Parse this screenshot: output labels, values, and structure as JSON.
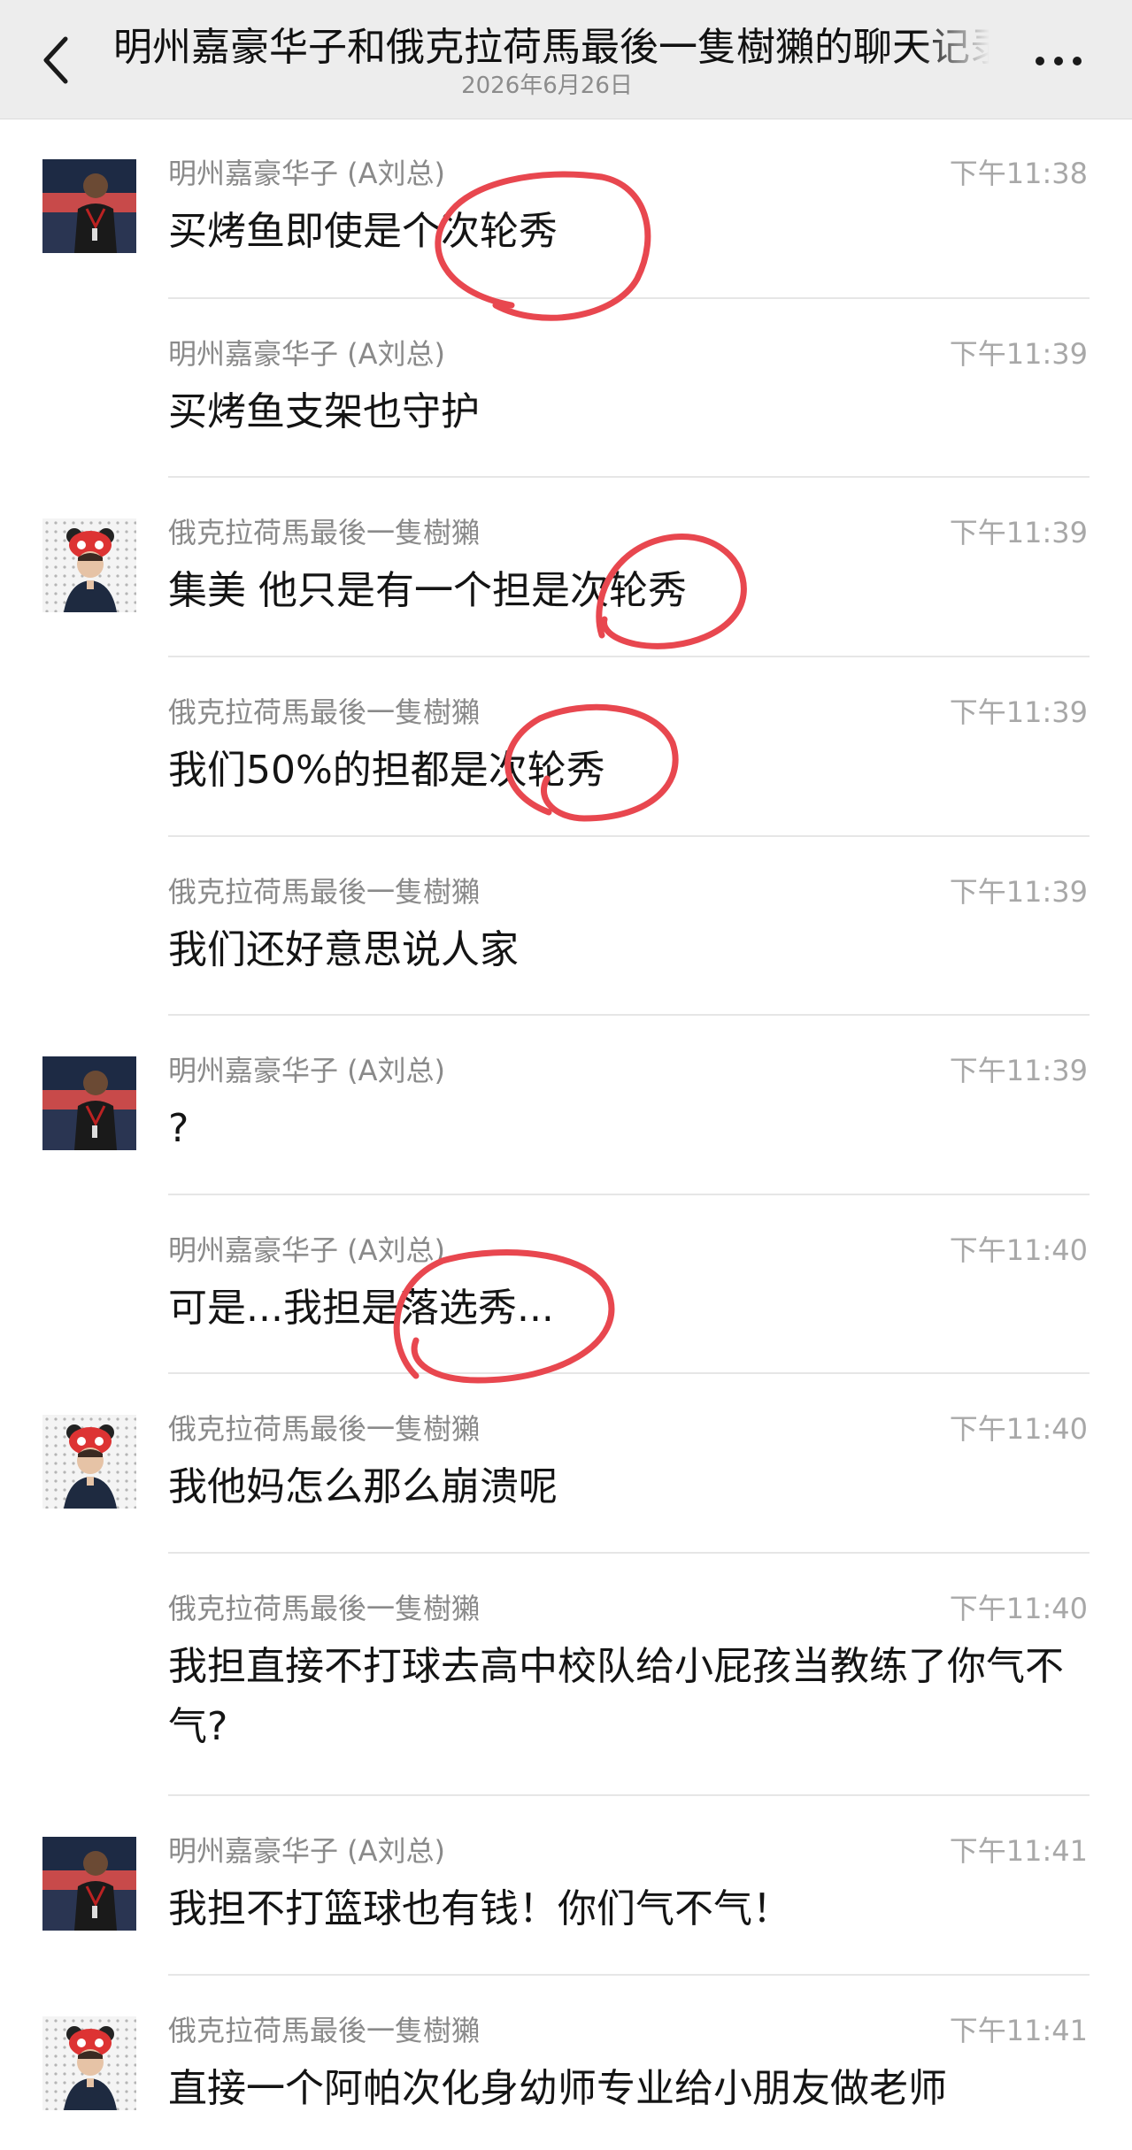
{
  "header": {
    "title": "明州嘉豪华子和俄克拉荷馬最後一隻樹獺的聊天记录",
    "subtitle": "2026年6月26日",
    "back_icon": "chevron-left-icon",
    "more_icon": "more-horizontal-icon"
  },
  "senders": {
    "a": "明州嘉豪华子 (A刘总)",
    "b": "俄克拉荷馬最後一隻樹獺"
  },
  "colors": {
    "header_bg": "#ededed",
    "annotation": "#e8474f"
  },
  "messages": [
    {
      "sender": "明州嘉豪华子 (A刘总)",
      "time": "下午11:38",
      "text": "买烤鱼即使是个次轮秀",
      "avatar": "avatar-basketball-player"
    },
    {
      "sender": "明州嘉豪华子 (A刘总)",
      "time": "下午11:39",
      "text": "买烤鱼支架也守护"
    },
    {
      "sender": "俄克拉荷馬最後一隻樹獺",
      "time": "下午11:39",
      "text": "集美 他只是有一个担是次轮秀",
      "avatar": "avatar-panda-hat"
    },
    {
      "sender": "俄克拉荷馬最後一隻樹獺",
      "time": "下午11:39",
      "text": "我们50%的担都是次轮秀"
    },
    {
      "sender": "俄克拉荷馬最後一隻樹獺",
      "time": "下午11:39",
      "text": "我们还好意思说人家"
    },
    {
      "sender": "明州嘉豪华子 (A刘总)",
      "time": "下午11:39",
      "text": "?",
      "avatar": "avatar-basketball-player"
    },
    {
      "sender": "明州嘉豪华子 (A刘总)",
      "time": "下午11:40",
      "text": "可是...我担是落选秀..."
    },
    {
      "sender": "俄克拉荷馬最後一隻樹獺",
      "time": "下午11:40",
      "text": "我他妈怎么那么崩溃呢",
      "avatar": "avatar-panda-hat"
    },
    {
      "sender": "俄克拉荷馬最後一隻樹獺",
      "time": "下午11:40",
      "text": "我担直接不打球去高中校队给小屁孩当教练了你气不气?"
    },
    {
      "sender": "明州嘉豪华子 (A刘总)",
      "time": "下午11:41",
      "text": "我担不打篮球也有钱！你们气不气！",
      "avatar": "avatar-basketball-player"
    },
    {
      "sender": "俄克拉荷馬最後一隻樹獺",
      "time": "下午11:41",
      "text": "直接一个阿帕次化身幼师专业给小朋友做老师",
      "avatar": "avatar-panda-hat"
    }
  ]
}
